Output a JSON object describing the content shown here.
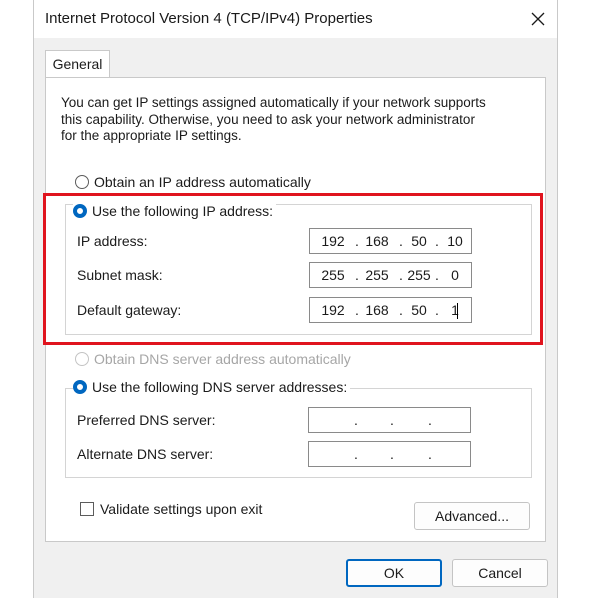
{
  "window": {
    "title": "Internet Protocol Version 4 (TCP/IPv4) Properties"
  },
  "icons": {
    "close": "close-icon"
  },
  "tabs": [
    {
      "label": "General",
      "selected": true
    }
  ],
  "description": [
    "You can get IP settings assigned automatically if your network supports",
    "this capability. Otherwise, you need to ask your network administrator",
    "for the appropriate IP settings."
  ],
  "ip": {
    "auto_label": "Obtain an IP address automatically",
    "auto_selected": false,
    "manual_label": "Use the following IP address:",
    "manual_selected": true,
    "fields": [
      {
        "label": "IP address:",
        "octets": [
          "192",
          "168",
          "50",
          "10"
        ]
      },
      {
        "label": "Subnet mask:",
        "octets": [
          "255",
          "255",
          "255",
          "0"
        ]
      },
      {
        "label": "Default gateway:",
        "octets": [
          "192",
          "168",
          "50",
          "1"
        ]
      }
    ]
  },
  "dns": {
    "auto_label": "Obtain DNS server address automatically",
    "auto_enabled": false,
    "manual_label": "Use the following DNS server addresses:",
    "manual_selected": true,
    "fields": [
      {
        "label": "Preferred DNS server:",
        "octets": [
          "",
          "",
          "",
          ""
        ]
      },
      {
        "label": "Alternate DNS server:",
        "octets": [
          "",
          "",
          "",
          ""
        ]
      }
    ]
  },
  "validate": {
    "label": "Validate settings upon exit",
    "checked": false
  },
  "buttons": {
    "advanced": "Advanced...",
    "ok": "OK",
    "cancel": "Cancel"
  },
  "colors": {
    "accent": "#0067c0",
    "highlight": "#e0141e"
  }
}
